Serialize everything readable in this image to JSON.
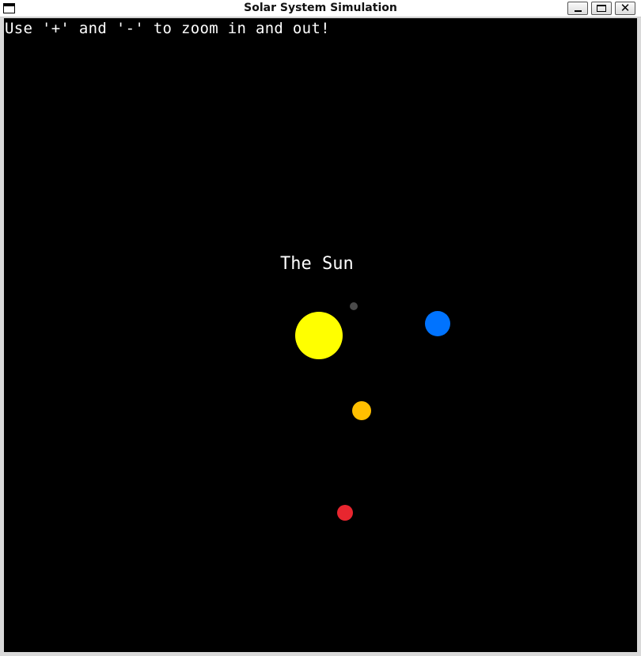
{
  "window": {
    "title": "Solar System Simulation",
    "close_glyph": "✕"
  },
  "canvas": {
    "hint": "Use '+' and '-' to zoom in and out!",
    "sun_label": "The Sun"
  },
  "bodies": {
    "sun": {
      "color": "#ffff00"
    },
    "grey_planet": {
      "color": "#4a4a4a"
    },
    "blue_planet": {
      "color": "#0073ff"
    },
    "orange_planet": {
      "color": "#ffbf00"
    },
    "red_planet": {
      "color": "#e8262f"
    }
  }
}
